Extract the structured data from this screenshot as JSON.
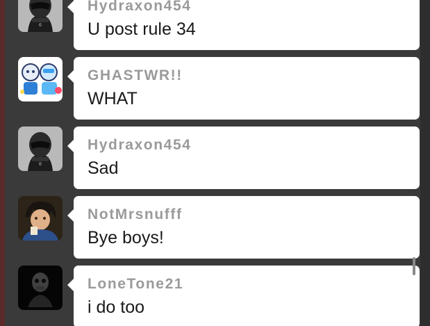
{
  "messages": [
    {
      "username": "Hydraxon454",
      "text": "U post rule 34",
      "avatar": "helmet-avatar"
    },
    {
      "username": "GHASTWR!!",
      "text": "WHAT",
      "avatar": "cartoon-characters-avatar"
    },
    {
      "username": "Hydraxon454",
      "text": "Sad",
      "avatar": "helmet-avatar"
    },
    {
      "username": "NotMrsnufff",
      "text": "Bye boys!",
      "avatar": "anime-character-avatar"
    },
    {
      "username": "LoneTone21",
      "text": "i do too",
      "avatar": "dark-skull-avatar"
    }
  ],
  "colors": {
    "background": "#3a3a3a",
    "bubble": "#ffffff",
    "username": "#9a9a9a",
    "text": "#1a1a1a"
  }
}
